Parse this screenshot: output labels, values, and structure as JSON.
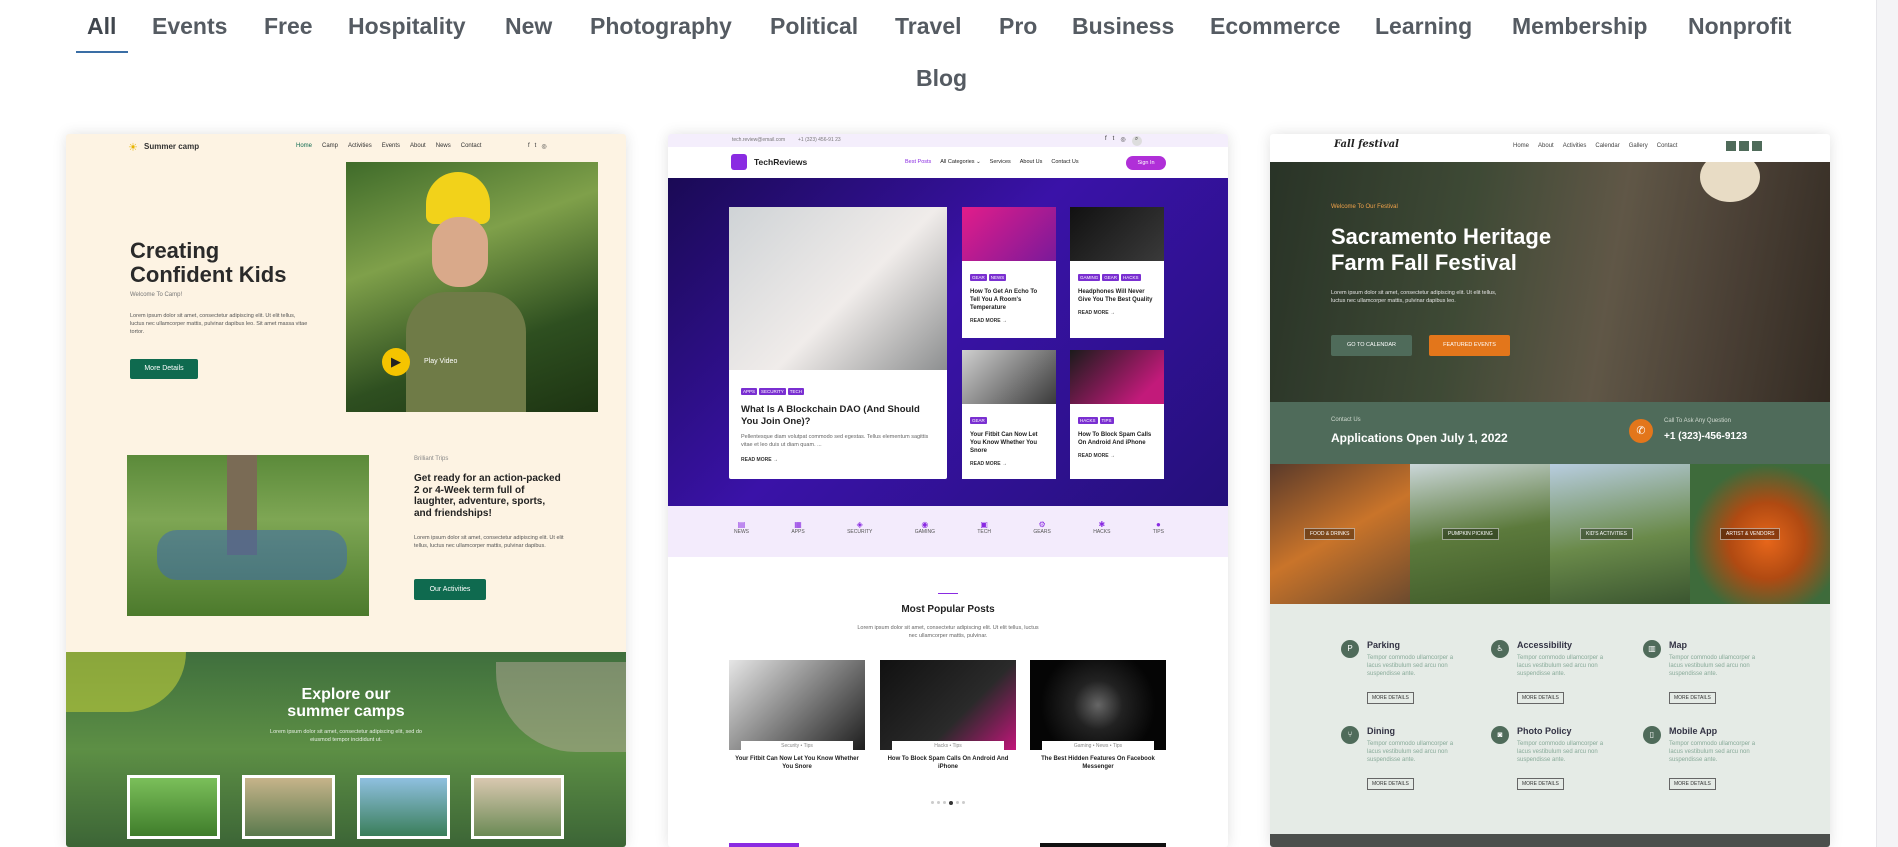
{
  "categories": {
    "items": [
      "All",
      "Events",
      "Free",
      "Hospitality",
      "New",
      "Photography",
      "Political",
      "Travel",
      "Pro",
      "Business",
      "Ecommerce",
      "Learning",
      "Membership",
      "Nonprofit",
      "Blog"
    ],
    "active": "All"
  },
  "camp": {
    "logo": "Summer camp",
    "nav": [
      "Home",
      "Camp",
      "Activities",
      "Events",
      "About",
      "News",
      "Contact"
    ],
    "hero_title_1": "Creating",
    "hero_title_2": "Confident Kids",
    "hero_sub": "Welcome To Camp!",
    "hero_body": "Lorem ipsum dolor sit amet, consectetur adipiscing elit. Ut elit tellus, luctus nec ullamcorper mattis, pulvinar dapibus leo. Sit amet massa vitae tortor.",
    "hero_button": "More Details",
    "play_label": "Play Video",
    "sec2_eyebrow": "Brilliant Trips",
    "sec2_title": "Get ready for an action-packed 2 or 4-Week term full of laughter, adventure, sports, and friendships!",
    "sec2_body": "Lorem ipsum dolor sit amet, consectetur adipiscing elit. Ut elit tellus, luctus nec ullamcorper mattis, pulvinar dapibus.",
    "sec2_button": "Our Activities",
    "explore_1": "Explore our",
    "explore_2": "summer camps",
    "explore_body": "Lorem ipsum dolor sit amet, consectetur adipiscing elit, sed do eiusmod tempor incididunt ut.",
    "colors": {
      "bg": "#fdf3e3",
      "accent": "#0f6a4f"
    }
  },
  "tech": {
    "topbar_email": "tech.review@email.com",
    "topbar_phone": "+1 (323) 456-91 23",
    "logo": "TechReviews",
    "nav": [
      "Best Posts",
      "All Categories ⌄",
      "Services",
      "About Us",
      "Contact Us"
    ],
    "sign_in": "Sign In",
    "main_post_tags": [
      "APPS",
      "SECURITY",
      "TECH"
    ],
    "main_post_title": "What Is A Blockchain DAO (And Should You Join One)?",
    "main_post_body": "Pellentesque diam volutpat commodo sed egestas. Tellus elementum sagittis vitae et leo duis ut diam quam. ...",
    "read_more": "READ MORE →",
    "side_posts": [
      {
        "tags": [
          "GEAR",
          "NEWS"
        ],
        "title": "How To Get An Echo To Tell You A Room's Temperature"
      },
      {
        "tags": [
          "GAMING",
          "GEAR",
          "HACKS"
        ],
        "title": "Headphones Will Never Give You The Best Quality"
      },
      {
        "tags": [
          "GEAR"
        ],
        "title": "Your Fitbit Can Now Let You Know Whether You Snore"
      },
      {
        "tags": [
          "HACKS",
          "TIPS"
        ],
        "title": "How To Block Spam Calls On Android And iPhone"
      }
    ],
    "cats": [
      "NEWS",
      "APPS",
      "SECURITY",
      "GAMING",
      "TECH",
      "GEARS",
      "HACKS",
      "TIPS"
    ],
    "popular_title": "Most Popular Posts",
    "popular_body": "Lorem ipsum dolor sit amet, consectetur adipiscing elit. Ut elit tellus, luctus nec ullamcorper mattis, pulvinar.",
    "popular": [
      {
        "meta": "Security • Tips",
        "title": "Your Fitbit Can Now Let You Know Whether You Snore"
      },
      {
        "meta": "Hacks • Tips",
        "title": "How To Block Spam Calls On Android And iPhone"
      },
      {
        "meta": "Gaming • News • Tips",
        "title": "The Best Hidden Features On Facebook Messenger"
      }
    ],
    "colors": {
      "accent": "#8a2be2",
      "hero": "#2a0a7a"
    }
  },
  "fest": {
    "logo": "Fall festival",
    "nav": [
      "Home",
      "About",
      "Activities",
      "Calendar",
      "Gallery",
      "Contact"
    ],
    "eyebrow": "Welcome To Our Festival",
    "title_1": "Sacramento Heritage",
    "title_2": "Farm Fall Festival",
    "body": "Lorem ipsum dolor sit amet, consectetur adipiscing elit. Ut elit tellus, luctus nec ullamcorper mattis, pulvinar dapibus leo.",
    "btn_calendar": "GO TO CALENDAR",
    "btn_events": "FEATURED EVENTS",
    "contact_eyebrow": "Contact Us",
    "contact_title": "Applications Open July 1, 2022",
    "call_label": "Call To Ask Any Question",
    "call_number": "+1 (323)-456-9123",
    "gallery": [
      "FOOD & DRINKS",
      "PUMPKIN PICKING",
      "KID'S ACTIVITIES",
      "ARTIST & VENDORS"
    ],
    "features": [
      {
        "icon": "parking-icon",
        "title": "Parking"
      },
      {
        "icon": "accessibility-icon",
        "title": "Accessibility"
      },
      {
        "icon": "map-icon",
        "title": "Map"
      },
      {
        "icon": "dining-icon",
        "title": "Dining"
      },
      {
        "icon": "camera-icon",
        "title": "Photo Policy"
      },
      {
        "icon": "mobile-icon",
        "title": "Mobile App"
      }
    ],
    "feature_desc": "Tempor commodo ullamcorper a lacus vestibulum sed arcu non suspendisse ante.",
    "more_details": "MORE DETAILS",
    "colors": {
      "green": "#4f6b5a",
      "orange": "#e3761b"
    }
  }
}
